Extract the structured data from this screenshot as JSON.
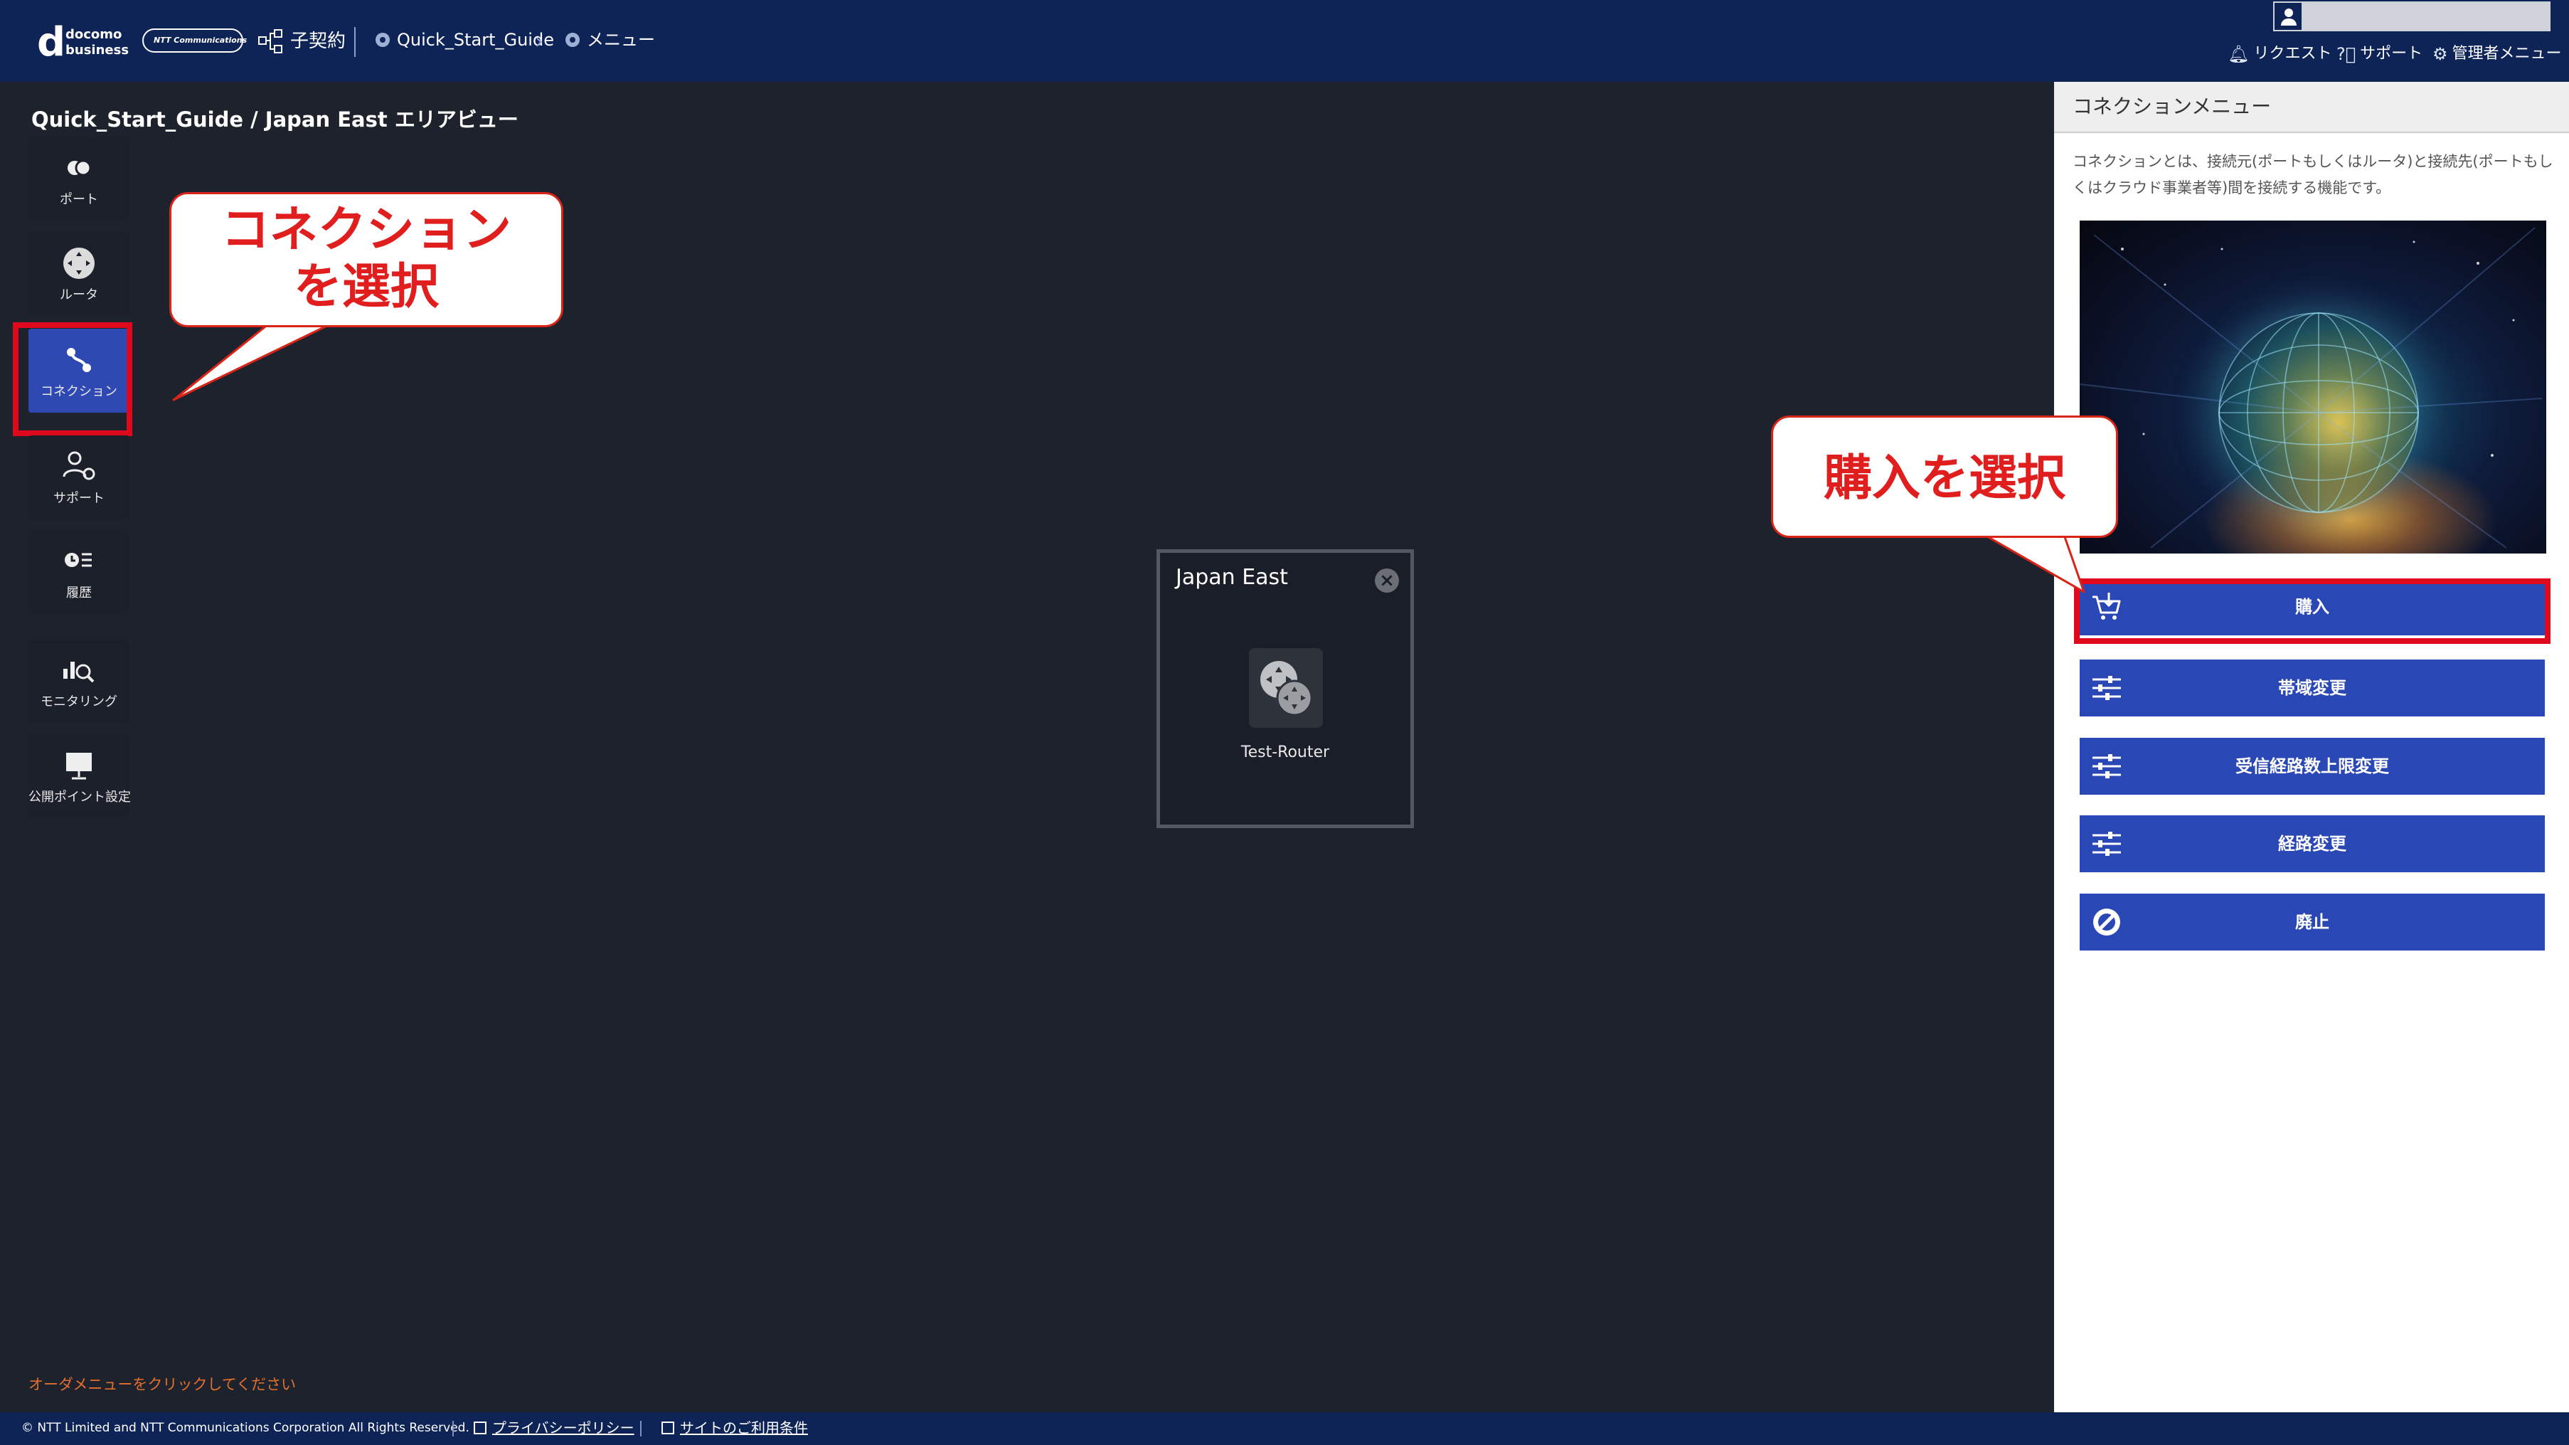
{
  "header": {
    "logo": {
      "d": "d",
      "line1": "docomo",
      "line2": "business"
    },
    "ntt_logo": "NTT Communications",
    "contract_label": "子契約",
    "breadcrumb": [
      "Quick_Start_Guide",
      "メニュー"
    ],
    "menu": [
      {
        "icon": "bell-icon",
        "label": "リクエスト"
      },
      {
        "icon": "help-icon",
        "label": "サポート"
      },
      {
        "icon": "gear-icon",
        "label": "管理者メニュー"
      }
    ]
  },
  "area_title": "Quick_Start_Guide / Japan East エリアビュー",
  "left_nav": [
    {
      "icon": "port-icon",
      "label": "ポート"
    },
    {
      "icon": "router-icon",
      "label": "ルータ"
    },
    {
      "icon": "connection-icon",
      "label": "コネクション",
      "active": true
    },
    {
      "icon": "support-icon",
      "label": "サポート"
    },
    {
      "icon": "history-icon",
      "label": "履歴"
    },
    {
      "icon": "monitoring-icon",
      "label": "モニタリング"
    },
    {
      "icon": "public-point-icon",
      "label": "公開ポイント設定"
    }
  ],
  "callouts": {
    "connection": [
      "コネクション",
      "を選択"
    ],
    "purchase": "購入を選択"
  },
  "area_card": {
    "title": "Japan East",
    "close": "×",
    "router_label": "Test-Router"
  },
  "panel": {
    "title": "コネクションメニュー",
    "description": "コネクションとは、接続元(ポートもしくはルータ)と接続先(ポートもしくはクラウド事業者等)間を接続する機能です。",
    "buttons": [
      {
        "icon": "cart-icon",
        "label": "購入"
      },
      {
        "icon": "sliders-icon",
        "label": "帯域変更"
      },
      {
        "icon": "sliders-icon",
        "label": "受信経路数上限変更"
      },
      {
        "icon": "sliders-icon",
        "label": "経路変更"
      },
      {
        "icon": "prohibit-icon",
        "label": "廃止"
      }
    ]
  },
  "hint": "オーダメニューをクリックしてください",
  "footer": {
    "copyright": "© NTT Limited and NTT Communications Corporation All Rights Reserved.",
    "links": [
      "プライバシーポリシー",
      "サイトのご利用条件"
    ]
  },
  "colors": {
    "header_bg": "#0e2457",
    "canvas_bg": "#1d222d",
    "button_blue": "#2a48b5",
    "active_nav": "#2e4ab2",
    "highlight_red": "#e0081d",
    "hint_orange": "#e36f2c"
  }
}
